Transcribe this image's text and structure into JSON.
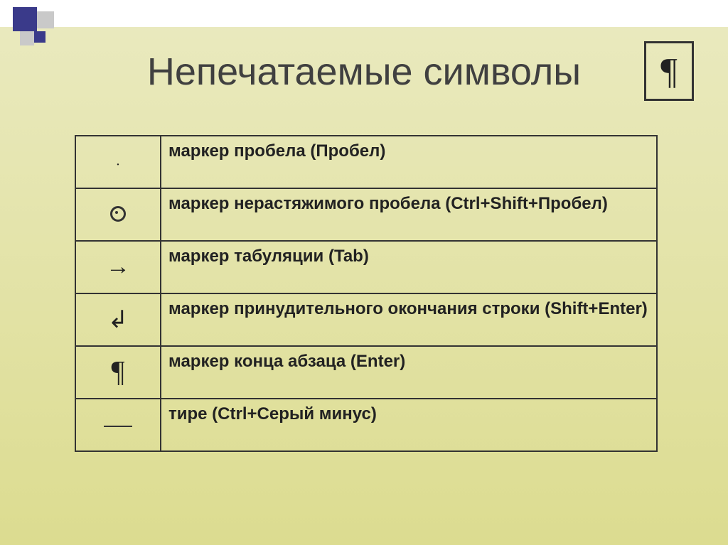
{
  "slide": {
    "title": "Непечатаемые символы",
    "pilcrow_badge": "¶"
  },
  "rows": [
    {
      "symbol": "·",
      "symbol_name": "space-marker",
      "description": "маркер пробела (Пробел)"
    },
    {
      "symbol": "◎",
      "symbol_name": "nbsp-marker",
      "description": "маркер нерастяжимого пробела (Ctrl+Shift+Пробел)"
    },
    {
      "symbol": "→",
      "symbol_name": "tab-marker",
      "description": "маркер табуляции (Tab)"
    },
    {
      "symbol": "↲",
      "symbol_name": "line-break-marker",
      "description": "маркер принудительного окончания строки (Shift+Enter)"
    },
    {
      "symbol": "¶",
      "symbol_name": "paragraph-marker",
      "description": "маркер конца абзаца (Enter)"
    },
    {
      "symbol": "—",
      "symbol_name": "dash-marker",
      "description": "тире (Ctrl+Серый минус)"
    }
  ]
}
